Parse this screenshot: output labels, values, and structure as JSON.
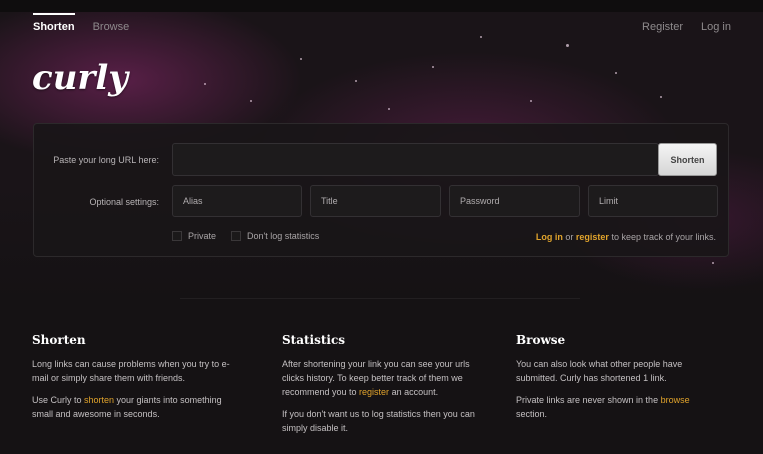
{
  "nav": {
    "left": [
      {
        "label": "Shorten",
        "active": true
      },
      {
        "label": "Browse",
        "active": false
      }
    ],
    "right": [
      {
        "label": "Register"
      },
      {
        "label": "Log in"
      }
    ]
  },
  "logo": "curly",
  "form": {
    "url_label": "Paste your long URL here:",
    "url_value": "",
    "shorten_button": "Shorten",
    "optional_label": "Optional settings:",
    "alias_placeholder": "Alias",
    "title_placeholder": "Title",
    "password_placeholder": "Password",
    "limit_placeholder": "Limit",
    "private_label": "Private",
    "nolog_label": "Don't log statistics",
    "note": {
      "login": "Log in",
      "or": " or ",
      "register": "register",
      "rest": " to keep track of your links."
    }
  },
  "columns": {
    "shorten": {
      "title": "Shorten",
      "p1": "Long links can cause problems when you try to e-mail or simply share them with friends.",
      "p2_pre": "Use Curly to ",
      "p2_link": "shorten",
      "p2_post": " your giants into something small and awesome in seconds."
    },
    "statistics": {
      "title": "Statistics",
      "p1_pre": "After shortening your link you can see your urls clicks history. To keep better track of them we recommend you to ",
      "p1_link": "register",
      "p1_post": " an account.",
      "p2": "If you don't want us to log statistics then you can simply disable it."
    },
    "browse": {
      "title": "Browse",
      "p1": "You can also look what other people have submitted. Curly has shortened 1 link.",
      "p2_pre": "Private links are never shown in the ",
      "p2_link": "browse",
      "p2_post": " section."
    }
  },
  "colors": {
    "accent": "#e0a32c",
    "background": "#151214"
  }
}
